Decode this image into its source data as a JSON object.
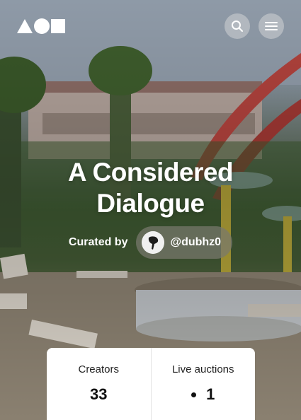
{
  "logo": {
    "shapes": [
      "triangle",
      "circle",
      "square"
    ],
    "color": "#ffffff"
  },
  "header": {
    "search_icon": "search-icon",
    "menu_icon": "hamburger-menu-icon"
  },
  "collection": {
    "title_line1": "A Considered",
    "title_line2": "Dialogue",
    "curated_label": "Curated by",
    "curator_handle": "@dubhz0"
  },
  "stats": {
    "creators_label": "Creators",
    "creators_value": "33",
    "auctions_label": "Live auctions",
    "auctions_value": "1",
    "live_indicator_color": "#111111"
  },
  "colors": {
    "card_background": "#ffffff",
    "text_primary": "#111111"
  }
}
